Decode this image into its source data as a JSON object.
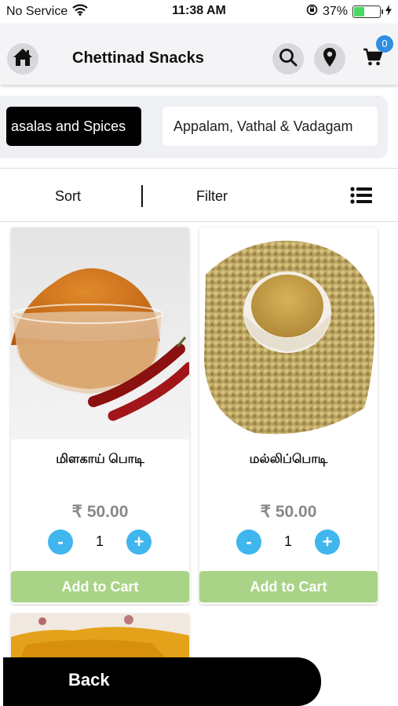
{
  "status_bar": {
    "carrier": "No Service",
    "time": "11:38 AM",
    "battery_percent": "37%",
    "battery_level": 0.37,
    "icons": [
      "wifi-icon",
      "orientation-lock-icon",
      "battery-icon",
      "charging-icon"
    ]
  },
  "header": {
    "title": "Chettinad Snacks",
    "cart_count": "0",
    "icons": [
      "home-icon",
      "search-icon",
      "location-pin-icon",
      "cart-icon"
    ]
  },
  "categories": [
    {
      "label": "asalas and Spices",
      "active": true
    },
    {
      "label": "Appalam, Vathal & Vadagam",
      "active": false
    }
  ],
  "toolbar": {
    "sort_label": "Sort",
    "filter_label": "Filter",
    "view_icon": "list-view-icon"
  },
  "products": [
    {
      "name": "மிளகாய் பொடி",
      "price": "₹ 50.00",
      "quantity": "1",
      "minus": "-",
      "plus": "+",
      "add_label": "Add to Cart"
    },
    {
      "name": "மல்லிப்பொடி",
      "price": "₹ 50.00",
      "quantity": "1",
      "minus": "-",
      "plus": "+",
      "add_label": "Add to Cart"
    }
  ],
  "footer": {
    "back_label": "Back"
  },
  "colors": {
    "accent_blue": "#3fb6ee",
    "add_to_cart": "#a9d386",
    "badge": "#2f8fe0",
    "active_chip": "#000000"
  }
}
